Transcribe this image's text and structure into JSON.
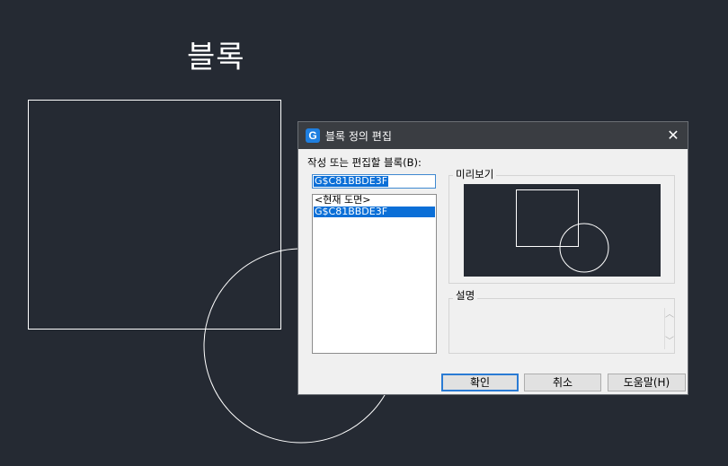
{
  "canvas": {
    "title": "블록"
  },
  "dialog": {
    "title": "블록 정의 편집",
    "app_icon_letter": "G",
    "close_glyph": "✕",
    "block_label": "작성 또는 편집할 블록(B):",
    "block_name_value": "G$C81BBDE3F",
    "block_list": [
      "<현재 도면>",
      "G$C81BBDE3F"
    ],
    "selected_index": 1,
    "preview_label": "미리보기",
    "description_label": "설명",
    "scroll_up_glyph": "︿",
    "scroll_down_glyph": "﹀",
    "buttons": {
      "ok": "확인",
      "cancel": "취소",
      "help": "도움말(H)"
    }
  },
  "colors": {
    "canvas_bg": "#252a33",
    "titlebar": "#3a3d42",
    "selection": "#0b6fd7",
    "default_button_border": "#2a7bd4"
  }
}
